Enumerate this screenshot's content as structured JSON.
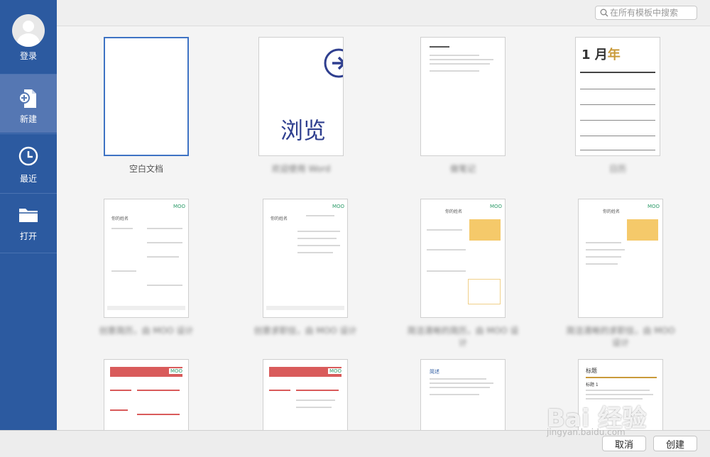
{
  "sidebar": {
    "items": [
      {
        "label": "登录",
        "icon": "avatar-icon"
      },
      {
        "label": "新建",
        "icon": "new-document-icon"
      },
      {
        "label": "最近",
        "icon": "clock-icon"
      },
      {
        "label": "打开",
        "icon": "folder-icon"
      }
    ]
  },
  "search": {
    "placeholder": "在所有模板中搜索"
  },
  "templates": {
    "blank": {
      "caption": "空白文档"
    },
    "tour": {
      "caption": "欢迎使用 Word",
      "thumb_text": "浏览"
    },
    "notes": {
      "caption": "做笔记"
    },
    "calendar": {
      "caption": "日历",
      "title_num": "1 月",
      "title_suffix": "年"
    },
    "resume1": {
      "caption": "创意简历，由 MOO 设计",
      "badge": "MOO",
      "name": "你的姓名"
    },
    "cover1": {
      "caption": "创意求职信，由 MOO 设计",
      "badge": "MOO",
      "name": "你的姓名"
    },
    "resume2": {
      "caption": "简洁清晰的简历，由 MOO 设计",
      "badge": "MOO",
      "name": "你的姓名"
    },
    "cover2": {
      "caption": "简洁清晰的求职信，由 MOO 设计",
      "badge": "MOO",
      "name": "你的姓名"
    },
    "resume3": {
      "badge": "MOO"
    },
    "cover3": {
      "badge": "MOO"
    },
    "notes2": {
      "heading": "简述"
    },
    "report": {
      "heading": "标题",
      "subheading": "标题 1"
    }
  },
  "buttons": {
    "cancel": "取消",
    "create": "创建"
  },
  "watermark": {
    "text": "Bai 经验",
    "url": "jingyan.baidu.com"
  },
  "colors": {
    "sidebar": "#2c5aa0",
    "sidebar_active": "#5577b3",
    "accent_blue": "#2f3f8f",
    "gold": "#c99a3a",
    "red": "#d95b5b",
    "moo_green": "#2e9c6a"
  }
}
